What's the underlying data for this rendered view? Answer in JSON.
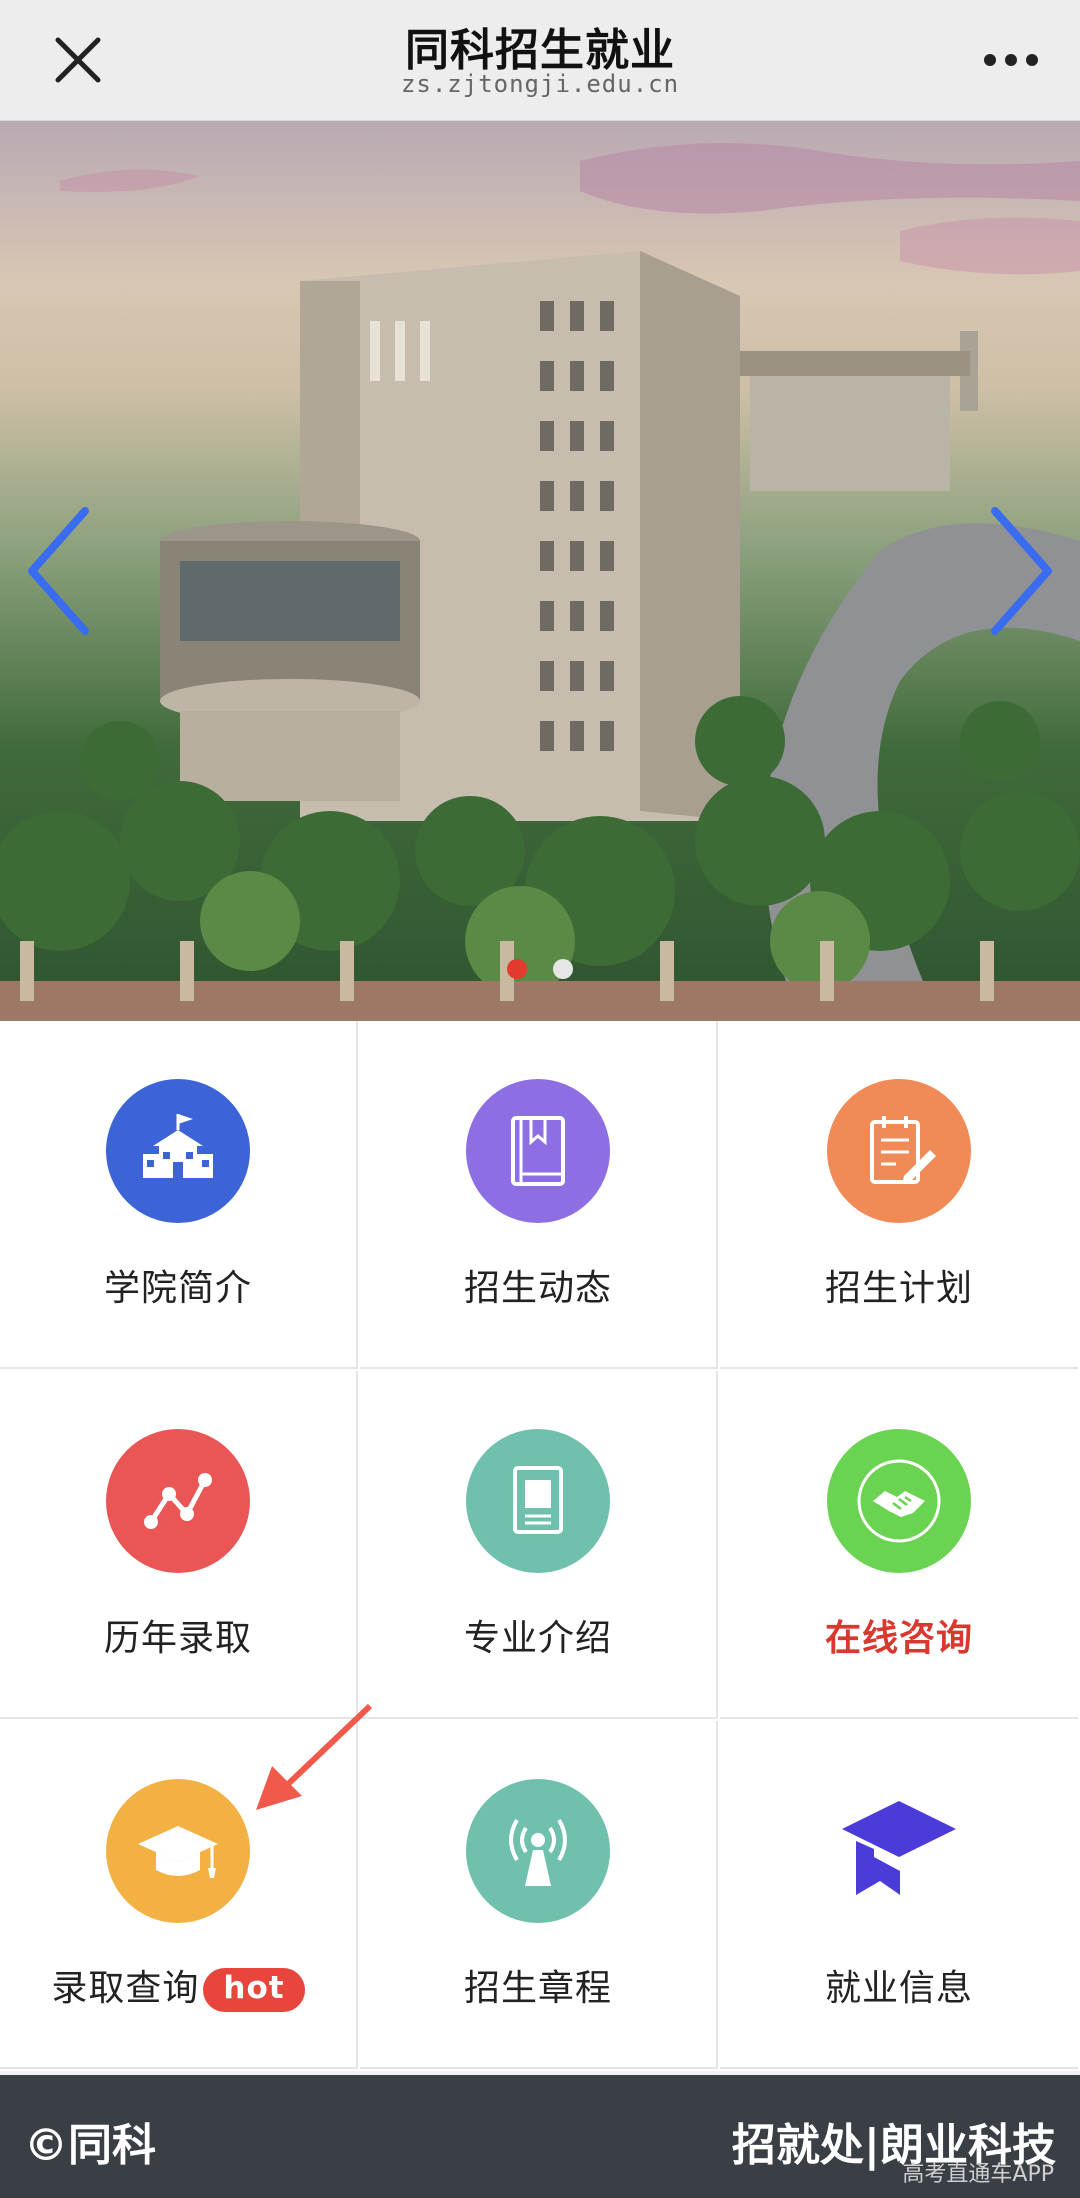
{
  "header": {
    "title": "同科招生就业",
    "url": "zs.zjtongji.edu.cn"
  },
  "banner": {
    "slide_count": 2,
    "active_slide": 1
  },
  "menu": {
    "items": [
      {
        "label": "学院简介",
        "icon": "school-icon",
        "color": "#3c64d6"
      },
      {
        "label": "招生动态",
        "icon": "book-icon",
        "color": "#8e6fe3"
      },
      {
        "label": "招生计划",
        "icon": "clipboard-icon",
        "color": "#f08b57"
      },
      {
        "label": "历年录取",
        "icon": "line-chart-icon",
        "color": "#ea5656"
      },
      {
        "label": "专业介绍",
        "icon": "profile-card-icon",
        "color": "#6fc1ad"
      },
      {
        "label": "在线咨询",
        "icon": "handshake-icon",
        "color": "#6bd352"
      },
      {
        "label": "录取查询",
        "icon": "graduation-cap-icon",
        "color": "#f4b143",
        "badge": "hot"
      },
      {
        "label": "招生章程",
        "icon": "broadcast-icon",
        "color": "#6fc1ad"
      },
      {
        "label": "就业信息",
        "icon": "mortarboard-icon",
        "color": "#4b3bd8"
      }
    ]
  },
  "footer": {
    "left": "©同科",
    "right": "招就处|朗业科技",
    "watermark": "高考直通车APP"
  },
  "colors": {
    "header_bg": "#ededed",
    "footer_bg": "#3a3f45",
    "dot_active": "#e23b2e",
    "dot_inactive": "#e6e6e6",
    "pointer_arrow": "#f15a4b",
    "hot_badge": "#e8453c"
  }
}
